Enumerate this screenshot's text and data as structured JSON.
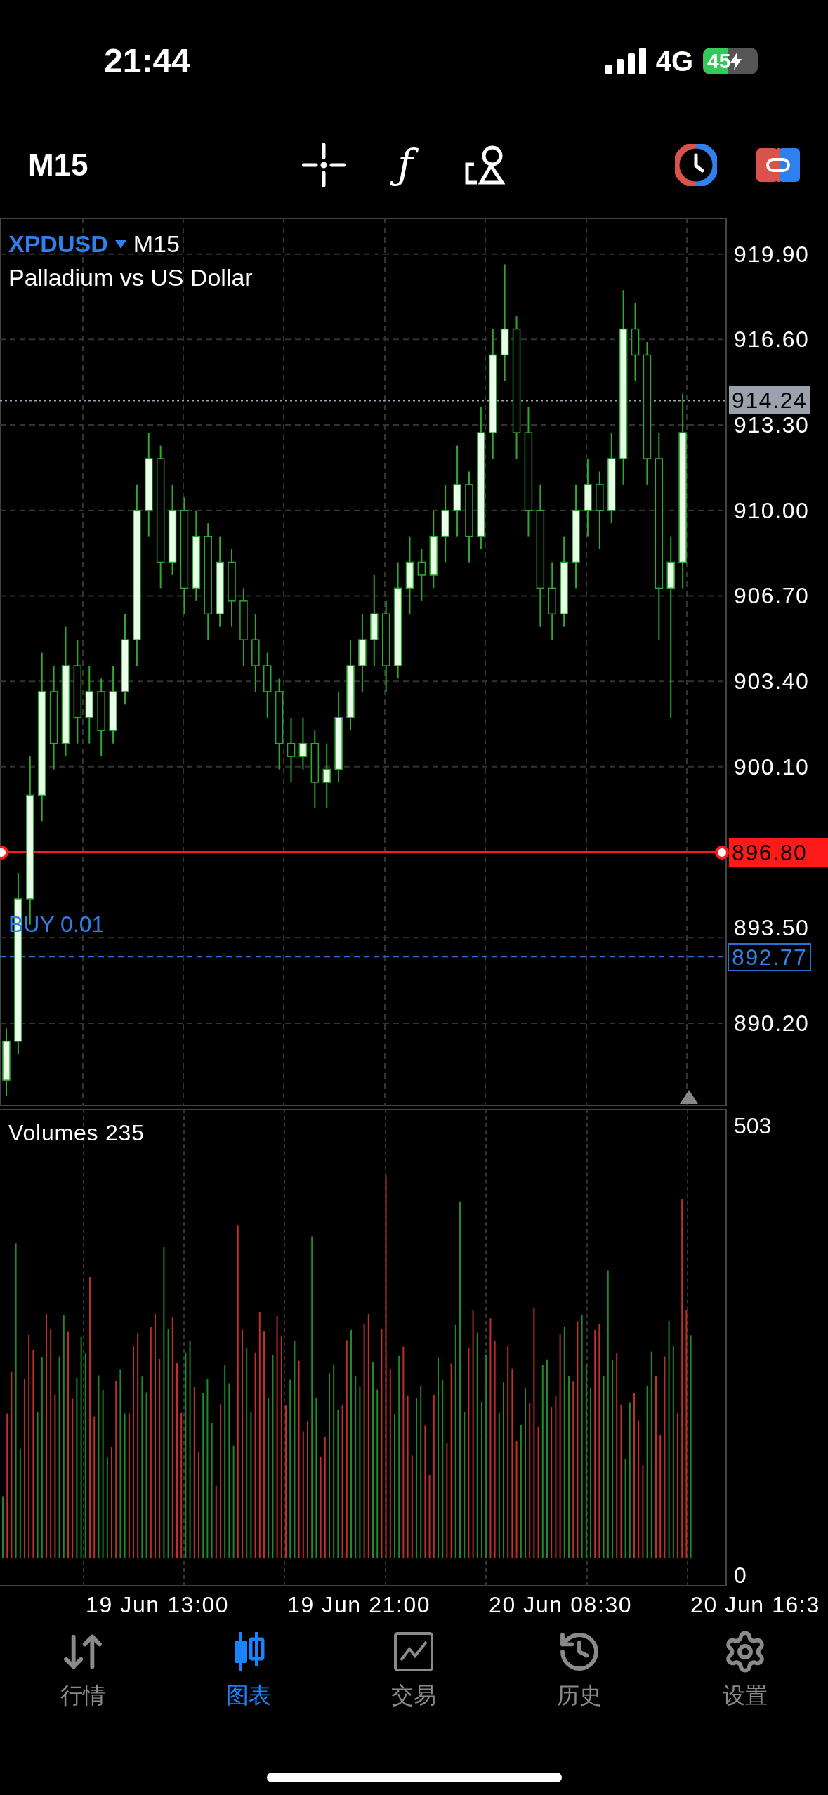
{
  "status_bar": {
    "time": "21:44",
    "network": "4G",
    "battery": "45",
    "charging": true
  },
  "toolbar": {
    "timeframe": "M15",
    "indicator_symbol": "ƒ"
  },
  "chart": {
    "symbol": "XPDUSD",
    "symbol_timeframe": "M15",
    "description": "Palladium vs US Dollar",
    "chart_data": {
      "type": "candlestick",
      "ylim": [
        887.0,
        921.3
      ],
      "grid": true,
      "yticks": [
        {
          "value": 919.9,
          "label": "919.90"
        },
        {
          "value": 916.6,
          "label": "916.60"
        },
        {
          "value": 913.3,
          "label": "913.30"
        },
        {
          "value": 910.0,
          "label": "910.00"
        },
        {
          "value": 906.7,
          "label": "906.70"
        },
        {
          "value": 903.4,
          "label": "903.40"
        },
        {
          "value": 900.1,
          "label": "900.10"
        },
        {
          "value": 893.5,
          "label": "893.50"
        },
        {
          "value": 890.2,
          "label": "890.20"
        }
      ],
      "ohlc": [
        [
          888,
          890,
          887.4,
          889.5
        ],
        [
          889.5,
          896,
          889,
          895
        ],
        [
          895,
          900.5,
          894,
          899
        ],
        [
          899,
          904.5,
          898,
          903
        ],
        [
          903,
          904,
          900,
          901
        ],
        [
          901,
          905.5,
          900.5,
          904
        ],
        [
          904,
          905,
          901,
          902
        ],
        [
          902,
          904,
          901,
          903
        ],
        [
          903,
          903.5,
          900.5,
          901.5
        ],
        [
          901.5,
          904,
          901,
          903
        ],
        [
          903,
          906,
          902.5,
          905
        ],
        [
          905,
          911,
          904,
          910
        ],
        [
          910,
          913,
          909,
          912
        ],
        [
          912,
          912.5,
          907,
          908
        ],
        [
          908,
          911,
          907.5,
          910
        ],
        [
          910,
          910.5,
          906,
          907
        ],
        [
          907,
          910,
          906.5,
          909
        ],
        [
          909,
          909.5,
          905,
          906
        ],
        [
          906,
          909,
          905.5,
          908
        ],
        [
          908,
          908.5,
          905.5,
          906.5
        ],
        [
          906.5,
          907,
          904,
          905
        ],
        [
          905,
          906,
          903,
          904
        ],
        [
          904,
          904.5,
          902,
          903
        ],
        [
          903,
          903.5,
          900,
          901
        ],
        [
          901,
          902,
          899.5,
          900.5
        ],
        [
          900.5,
          902,
          900,
          901
        ],
        [
          901,
          901.5,
          898.5,
          899.5
        ],
        [
          899.5,
          901,
          898.5,
          900
        ],
        [
          900,
          903,
          899.5,
          902
        ],
        [
          902,
          905,
          901.5,
          904
        ],
        [
          904,
          906,
          903,
          905
        ],
        [
          905,
          907.5,
          904,
          906
        ],
        [
          906,
          906.5,
          903,
          904
        ],
        [
          904,
          908,
          903.5,
          907
        ],
        [
          907,
          909,
          906,
          908
        ],
        [
          908,
          908.5,
          906.5,
          907.5
        ],
        [
          907.5,
          910,
          907,
          909
        ],
        [
          909,
          911,
          908,
          910
        ],
        [
          910,
          912.5,
          909,
          911
        ],
        [
          911,
          911.5,
          908,
          909
        ],
        [
          909,
          914,
          908.5,
          913
        ],
        [
          913,
          917,
          912,
          916
        ],
        [
          916,
          919.5,
          915,
          917
        ],
        [
          917,
          917.5,
          912,
          913
        ],
        [
          913,
          914,
          909,
          910
        ],
        [
          910,
          911,
          905.5,
          907
        ],
        [
          907,
          908,
          905,
          906
        ],
        [
          906,
          909,
          905.5,
          908
        ],
        [
          908,
          911,
          907,
          910
        ],
        [
          910,
          912,
          909,
          911
        ],
        [
          911,
          911.5,
          908.5,
          910
        ],
        [
          910,
          913,
          909.5,
          912
        ],
        [
          912,
          918.5,
          911,
          917
        ],
        [
          917,
          918,
          915,
          916
        ],
        [
          916,
          916.5,
          911,
          912
        ],
        [
          912,
          913,
          905,
          907
        ],
        [
          907,
          909,
          902,
          908
        ],
        [
          908,
          914.5,
          907,
          913
        ]
      ],
      "ref_lines": [
        {
          "axis": "y",
          "value": 914.24,
          "label": "914.24",
          "color": "#9aa3ad"
        },
        {
          "axis": "y",
          "value": 896.8,
          "label": "896.80",
          "color": "#ff1a1a"
        },
        {
          "axis": "y",
          "value": 892.77,
          "label": "892.77",
          "color": "#2a6fd0"
        }
      ]
    },
    "order_label": "BUY 0.01"
  },
  "volume": {
    "title": "Volumes 235",
    "max": "503",
    "min": "0"
  },
  "time_axis": [
    "19 Jun 13:00",
    "19 Jun 21:00",
    "20 Jun 08:30",
    "20 Jun 16:3"
  ],
  "tabs": [
    {
      "label": "行情",
      "selected": false
    },
    {
      "label": "图表",
      "selected": true
    },
    {
      "label": "交易",
      "selected": false
    },
    {
      "label": "历史",
      "selected": false
    },
    {
      "label": "设置",
      "selected": false
    }
  ]
}
